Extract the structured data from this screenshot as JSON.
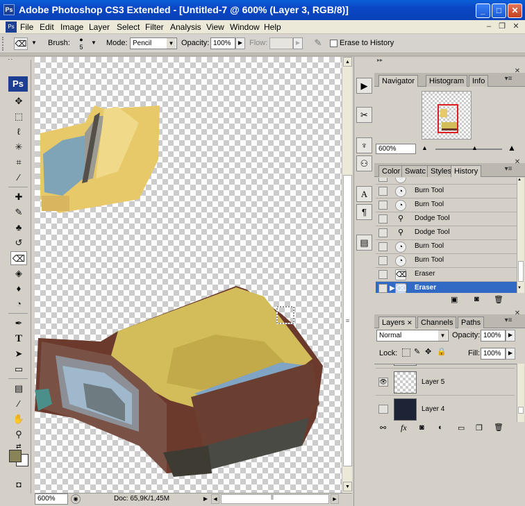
{
  "window": {
    "app_icon": "Ps",
    "title": "Adobe Photoshop CS3 Extended - [Untitled-7 @ 600% (Layer 3, RGB/8)]",
    "controls": [
      "minimize-icon",
      "maximize-icon",
      "close-icon"
    ]
  },
  "menu": {
    "items": [
      "File",
      "Edit",
      "Image",
      "Layer",
      "Select",
      "Filter",
      "Analysis",
      "View",
      "Window",
      "Help"
    ],
    "doc_controls": [
      "–",
      "❐",
      "✕"
    ]
  },
  "options": {
    "brush_label": "Brush:",
    "brush_size": "5",
    "mode_label": "Mode:",
    "mode_value": "Pencil",
    "opacity_label": "Opacity:",
    "opacity_value": "100%",
    "flow_label": "Flow:",
    "flow_value": "",
    "erase_history_label": "Erase to History",
    "erase_history_checked": false
  },
  "toolbox": {
    "logo": "Ps",
    "tools": [
      "move-tool-icon",
      "marquee-tool-icon",
      "lasso-tool-icon",
      "magic-wand-icon",
      "crop-tool-icon",
      "slice-tool-icon",
      "healing-brush-icon",
      "brush-tool-icon",
      "clone-stamp-icon",
      "history-brush-icon",
      "eraser-tool-icon",
      "paint-bucket-icon",
      "blur-tool-icon",
      "dodge-tool-icon",
      "pen-tool-icon",
      "type-tool-icon",
      "path-selection-icon",
      "rectangle-tool-icon",
      "notes-tool-icon",
      "eyedropper-icon",
      "hand-tool-icon",
      "zoom-tool-icon"
    ],
    "fg_color": "#8a8358",
    "bg_color": "#ffffff"
  },
  "status": {
    "zoom": "600%",
    "doc": "Doc: 65,9K/1,45M"
  },
  "navigator": {
    "tabs": [
      "Navigator",
      "Histogram",
      "Info"
    ],
    "zoom": "600%"
  },
  "history": {
    "tabs": [
      "Color",
      "Swatc",
      "Styles",
      "History"
    ],
    "rows": [
      {
        "label": "",
        "icon": "burn-tool-icon"
      },
      {
        "label": "Burn Tool",
        "icon": "burn-tool-icon"
      },
      {
        "label": "Burn Tool",
        "icon": "burn-tool-icon"
      },
      {
        "label": "Dodge Tool",
        "icon": "dodge-tool-icon"
      },
      {
        "label": "Dodge Tool",
        "icon": "dodge-tool-icon"
      },
      {
        "label": "Burn Tool",
        "icon": "burn-tool-icon"
      },
      {
        "label": "Burn Tool",
        "icon": "burn-tool-icon"
      },
      {
        "label": "Eraser",
        "icon": "eraser-icon"
      },
      {
        "label": "Eraser",
        "icon": "eraser-icon",
        "selected": true
      }
    ]
  },
  "layers": {
    "tabs": [
      "Layers",
      "Channels",
      "Paths"
    ],
    "blend_mode": "Normal",
    "opacity_label": "Opacity:",
    "opacity_value": "100%",
    "lock_label": "Lock:",
    "fill_label": "Fill:",
    "fill_value": "100%",
    "rows": [
      {
        "name": "Layer 5",
        "visible": true
      },
      {
        "name": "Layer 4",
        "visible": false
      }
    ]
  },
  "colors": {
    "title_blue": "#0a46c4",
    "selection_blue": "#316ac5",
    "panel_gray": "#d4d0c8"
  }
}
